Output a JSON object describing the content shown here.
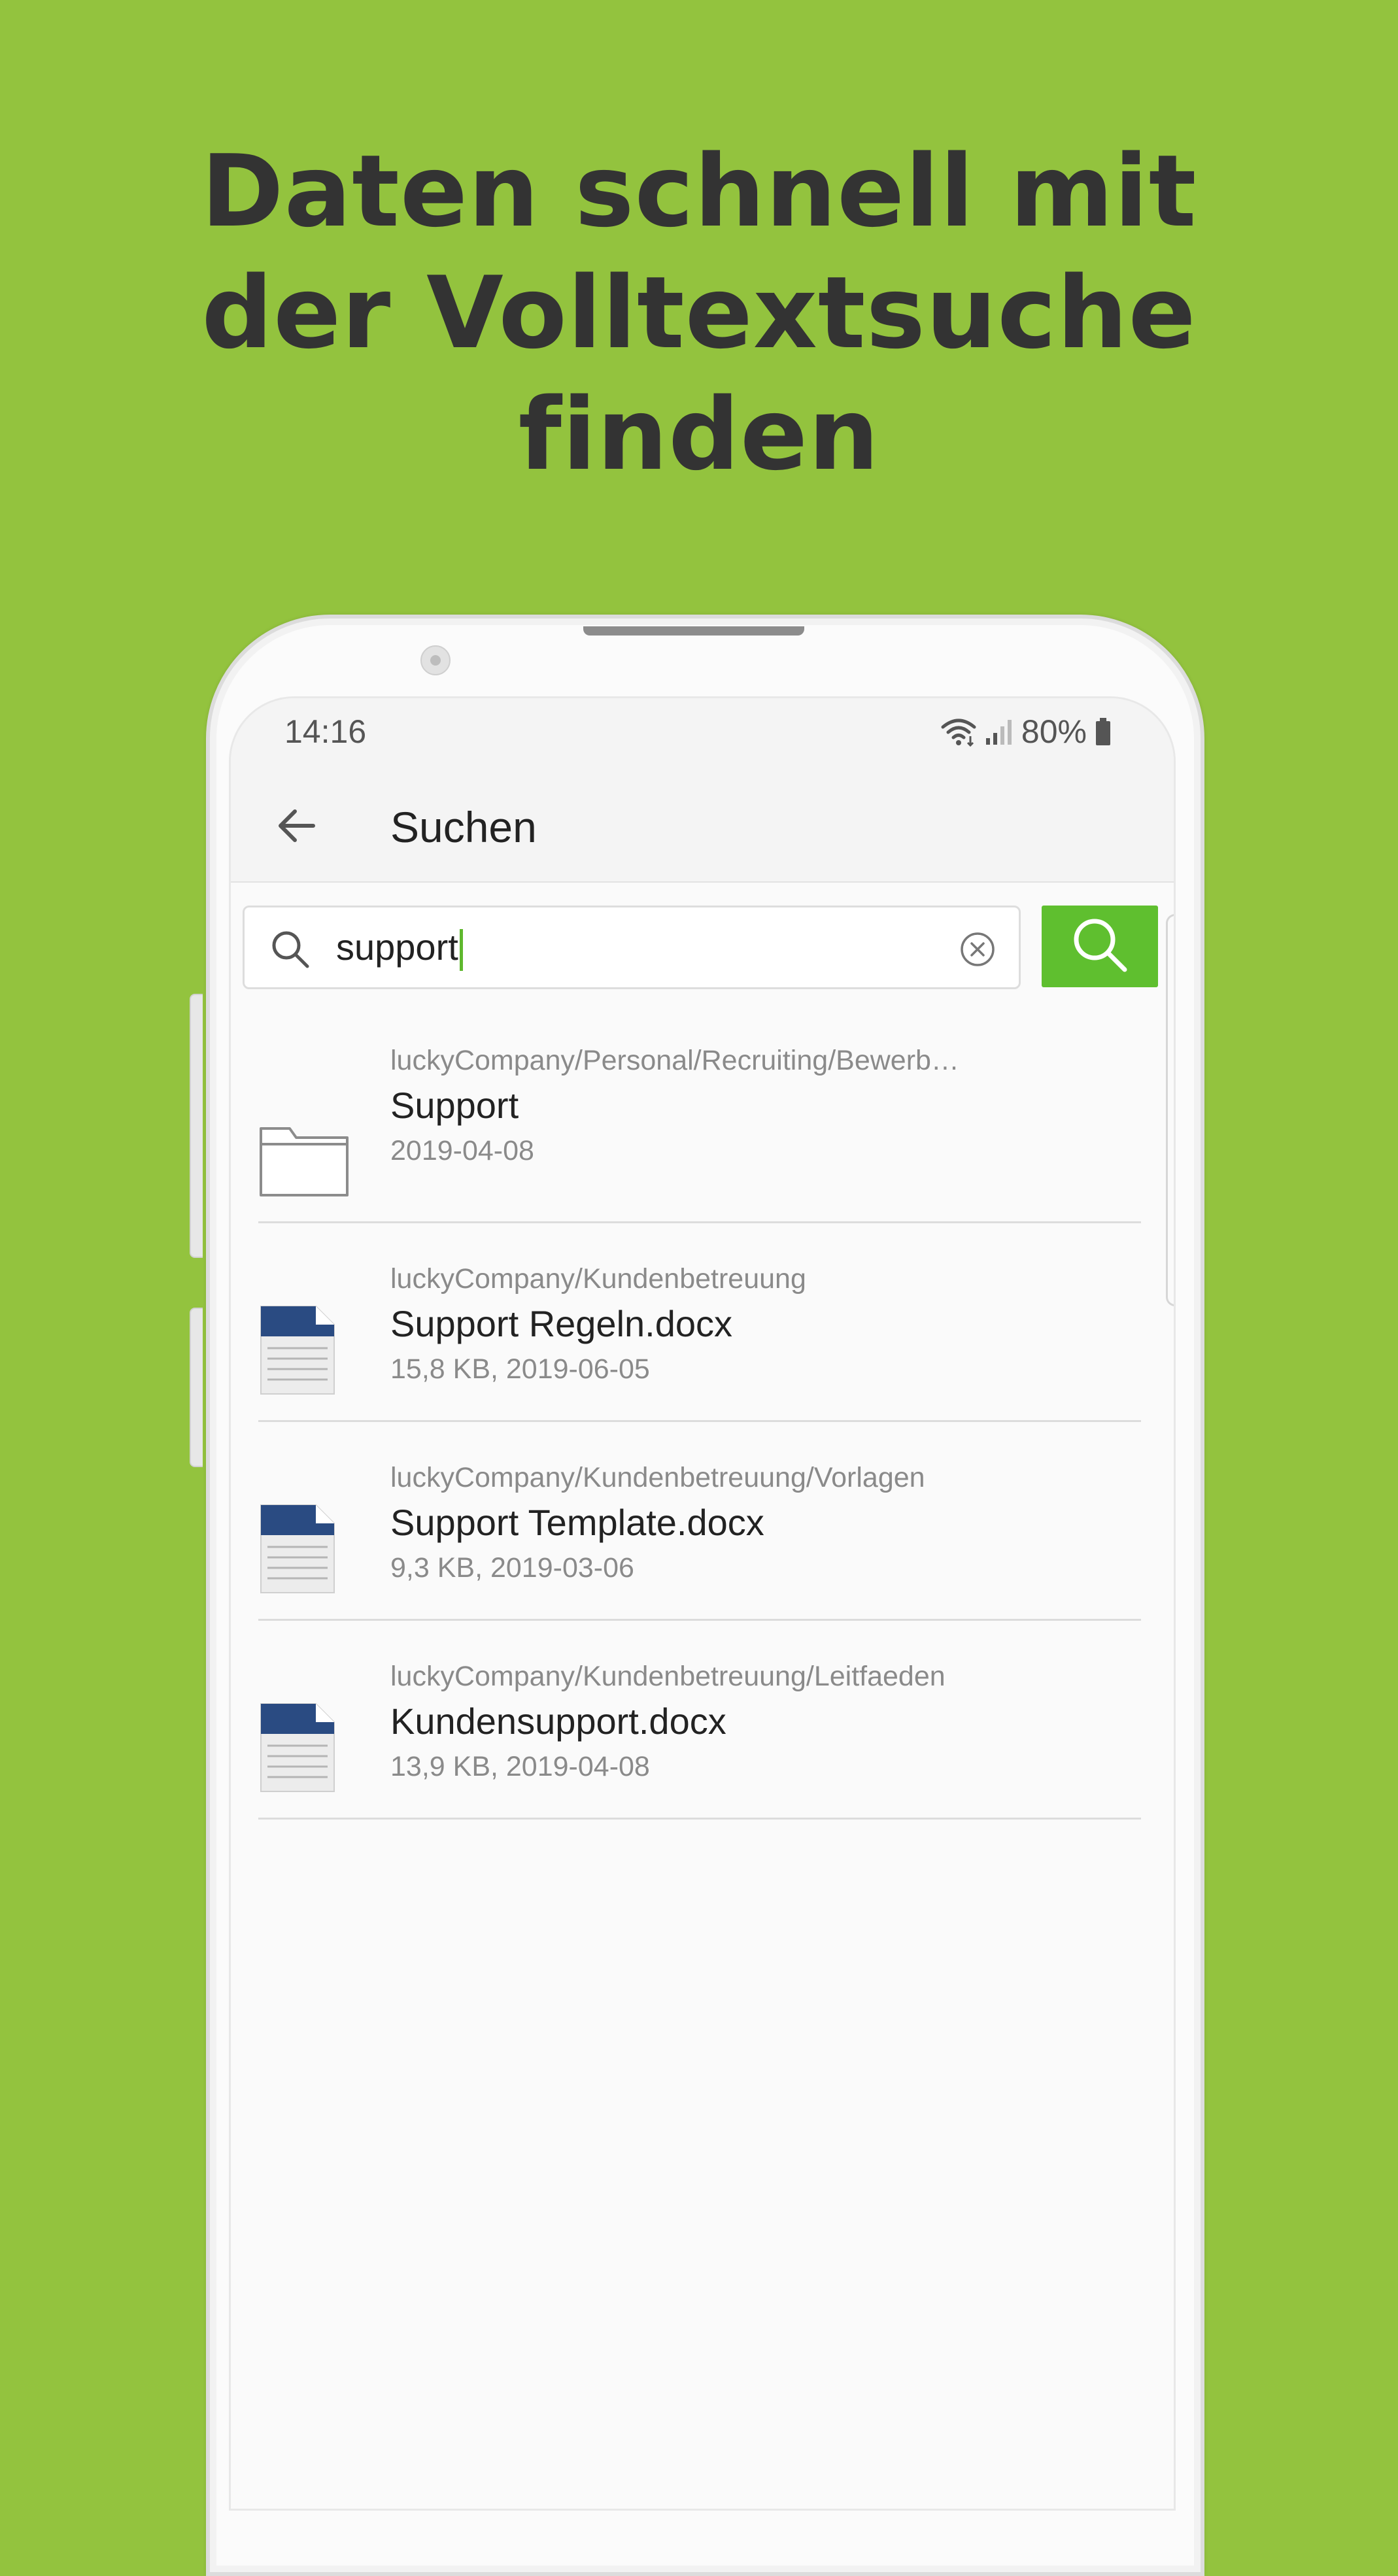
{
  "headline": {
    "line1": "Daten schnell mit",
    "line2": "der Volltextsuche",
    "line3": "finden"
  },
  "status_bar": {
    "time": "14:16",
    "battery": "80%"
  },
  "app_bar": {
    "title": "Suchen"
  },
  "search": {
    "value": "support"
  },
  "results": [
    {
      "type": "folder",
      "path": "luckyCompany/Personal/Recruiting/Bewerb…",
      "name": "Support",
      "meta": "2019-04-08"
    },
    {
      "type": "docx",
      "path": "luckyCompany/Kundenbetreuung",
      "name": "Support Regeln.docx",
      "meta": "15,8 KB, 2019-06-05"
    },
    {
      "type": "docx",
      "path": "luckyCompany/Kundenbetreuung/Vorlagen",
      "name": "Support Template.docx",
      "meta": "9,3 KB, 2019-03-06"
    },
    {
      "type": "docx",
      "path": "luckyCompany/Kundenbetreuung/Leitfaeden",
      "name": "Kundensupport.docx",
      "meta": "13,9 KB, 2019-04-08"
    }
  ],
  "colors": {
    "background": "#93c33e",
    "headline": "#333333",
    "accent_button": "#5fbf2f",
    "doc_header": "#2a4b82"
  },
  "icons": {
    "back": "arrow-left-icon",
    "search": "search-icon",
    "clear": "clear-circle-icon",
    "folder": "folder-icon",
    "document": "docx-file-icon",
    "wifi": "wifi-icon",
    "signal": "signal-icon",
    "battery": "battery-icon"
  }
}
